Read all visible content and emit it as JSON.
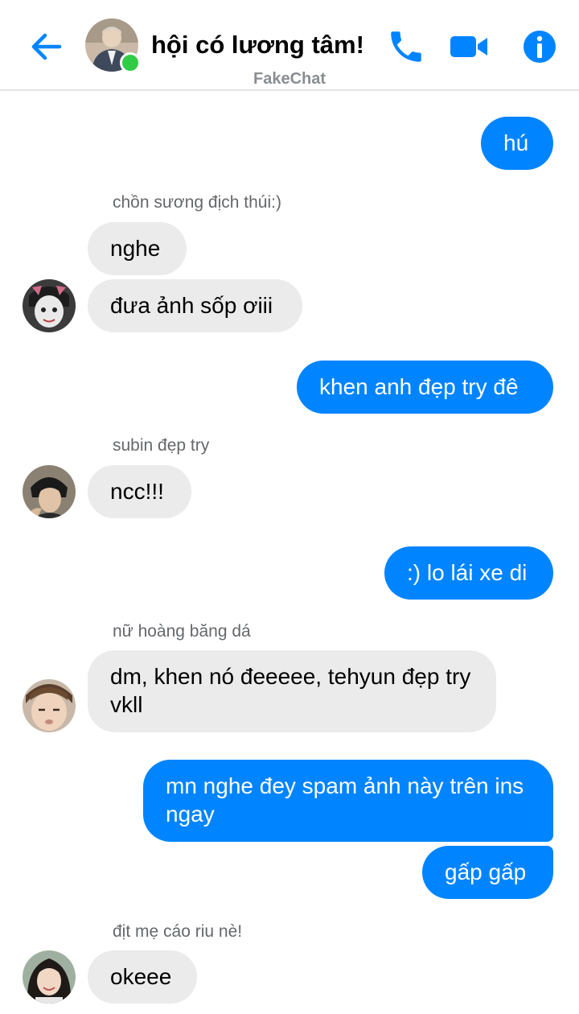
{
  "header": {
    "title": "hội có lương tâm!",
    "subtitle": "FakeChat",
    "icons": {
      "back": "arrow-left-icon",
      "call": "phone-icon",
      "video": "video-camera-icon",
      "info": "info-icon"
    },
    "accent_color": "#0084ff",
    "online_color": "#31cc46"
  },
  "messages": [
    {
      "type": "out",
      "text": "hú"
    },
    {
      "type": "sender",
      "text": "chồn sương địch thúi:)"
    },
    {
      "type": "in",
      "text": "nghe"
    },
    {
      "type": "in",
      "text": "đưa ảnh sốp ơiii"
    },
    {
      "type": "out",
      "text": "khen anh đẹp try đê"
    },
    {
      "type": "sender",
      "text": "subin đẹp try"
    },
    {
      "type": "in",
      "text": "ncc!!!"
    },
    {
      "type": "out",
      "text": ":) lo lái xe di"
    },
    {
      "type": "sender",
      "text": "nữ hoàng băng dá"
    },
    {
      "type": "in",
      "text": "dm, khen nó đeeeee, tehyun đẹp try vkll"
    },
    {
      "type": "out",
      "text": "mn nghe đey spam ảnh này trên ins ngay"
    },
    {
      "type": "out",
      "text": "gấp gấp"
    },
    {
      "type": "sender",
      "text": "địt mẹ cáo riu nè!"
    },
    {
      "type": "in",
      "text": "okeee"
    }
  ]
}
